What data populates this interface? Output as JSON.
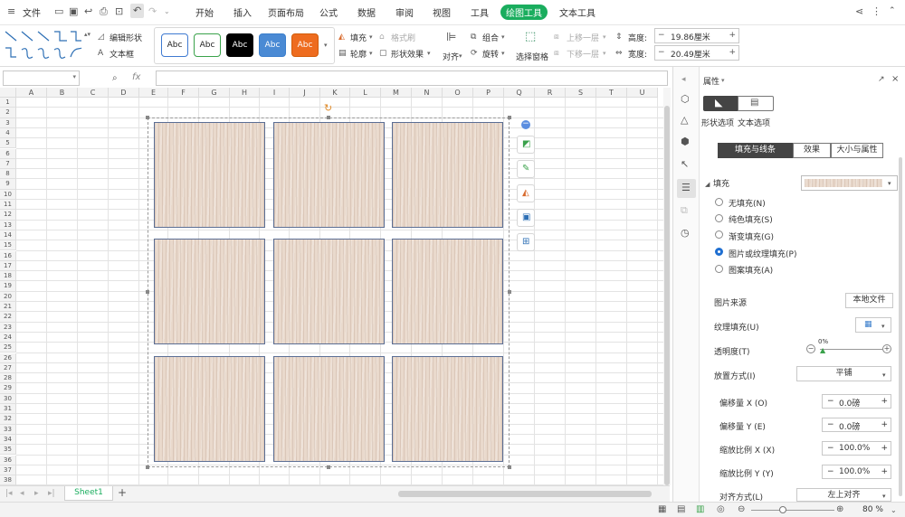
{
  "menubar": {
    "file": "文件",
    "tabs": [
      "开始",
      "插入",
      "页面布局",
      "公式",
      "数据",
      "审阅",
      "视图",
      "工具",
      "绘图工具",
      "文本工具"
    ]
  },
  "ribbon": {
    "edit_shape": "编辑形状",
    "text_box": "文本框",
    "style_label": "Abc",
    "fill": "填充",
    "outline": "轮廓",
    "format_brush": "格式刷",
    "shape_effects": "形状效果",
    "align": "对齐",
    "group": "组合",
    "rotate": "旋转",
    "selection_pane": "选择窗格",
    "bring_forward": "上移一层",
    "send_backward": "下移一层",
    "height_label": "高度:",
    "height_value": "19.86厘米",
    "width_label": "宽度:",
    "width_value": "20.49厘米"
  },
  "formula": {
    "fx": "fx",
    "name_box": ""
  },
  "columns": [
    "A",
    "B",
    "C",
    "D",
    "E",
    "F",
    "G",
    "H",
    "I",
    "J",
    "K",
    "L",
    "M",
    "N",
    "O",
    "P",
    "Q",
    "R",
    "S",
    "T",
    "U"
  ],
  "rows": [
    "1",
    "2",
    "3",
    "4",
    "5",
    "6",
    "7",
    "8",
    "9",
    "10",
    "11",
    "12",
    "13",
    "14",
    "15",
    "16",
    "17",
    "18",
    "19",
    "20",
    "21",
    "22",
    "23",
    "24",
    "25",
    "26",
    "27",
    "28",
    "29",
    "30",
    "31",
    "32",
    "33",
    "34",
    "35",
    "36",
    "37",
    "38"
  ],
  "sheet": {
    "tab": "Sheet1",
    "add": "+"
  },
  "panel": {
    "title": "属性",
    "shape_options": "形状选项",
    "text_options": "文本选项",
    "tabs": [
      "填充与线条",
      "效果",
      "大小与属性"
    ],
    "fill_header": "填充",
    "fill_options": [
      "无填充(N)",
      "纯色填充(S)",
      "渐变填充(G)",
      "图片或纹理填充(P)",
      "图案填充(A)"
    ],
    "selected_fill_index": 3,
    "picture_source": "图片来源",
    "local_file": "本地文件",
    "texture_fill": "纹理填充(U)",
    "transparency": "透明度(T)",
    "transparency_value": "0%",
    "placement": "放置方式(I)",
    "placement_value": "平铺",
    "offset_x": "偏移量 X (O)",
    "offset_x_value": "0.0磅",
    "offset_y": "偏移量 Y (E)",
    "offset_y_value": "0.0磅",
    "scale_x": "缩放比例 X (X)",
    "scale_x_value": "100.0%",
    "scale_y": "缩放比例 Y (Y)",
    "scale_y_value": "100.0%",
    "alignment": "对齐方式(L)",
    "alignment_value": "左上对齐"
  },
  "status": {
    "zoom": "80 %"
  },
  "colors": {
    "accent": "#1aad5e",
    "selection": "#1f6fd1",
    "shape_border": "#5b6e94",
    "wood": "#e9d9cc"
  }
}
